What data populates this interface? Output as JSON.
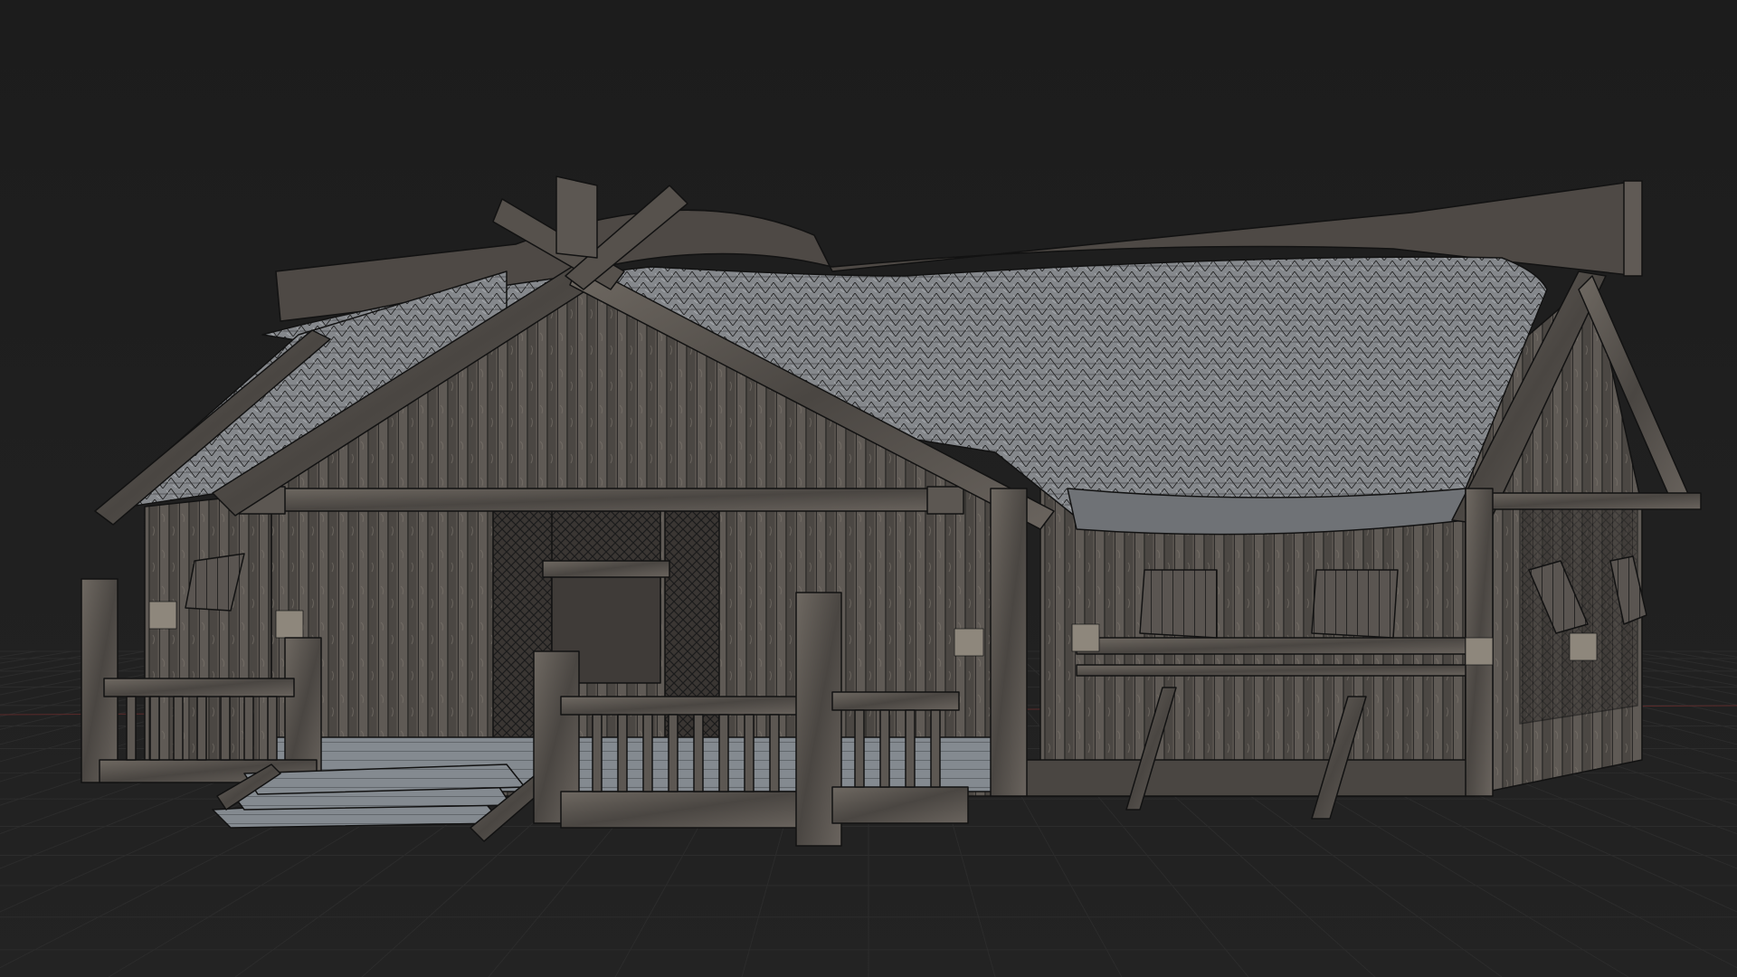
{
  "viewport": {
    "background": "#1d1d1d",
    "grid_color": "#2c2c2c",
    "x_axis_color": "#5a2a2a"
  },
  "scene": {
    "object": "wooden-house-model",
    "display_mode": "textured-wireframe",
    "colors": {
      "wood_dark": "#3c3835",
      "wood_mid": "#5d5853",
      "wood_light": "#7d776f",
      "thatch": "#8b8e92",
      "thatch_light": "#b9bcc0",
      "wire": "#111111",
      "porch_floor": "#8a9096"
    }
  }
}
